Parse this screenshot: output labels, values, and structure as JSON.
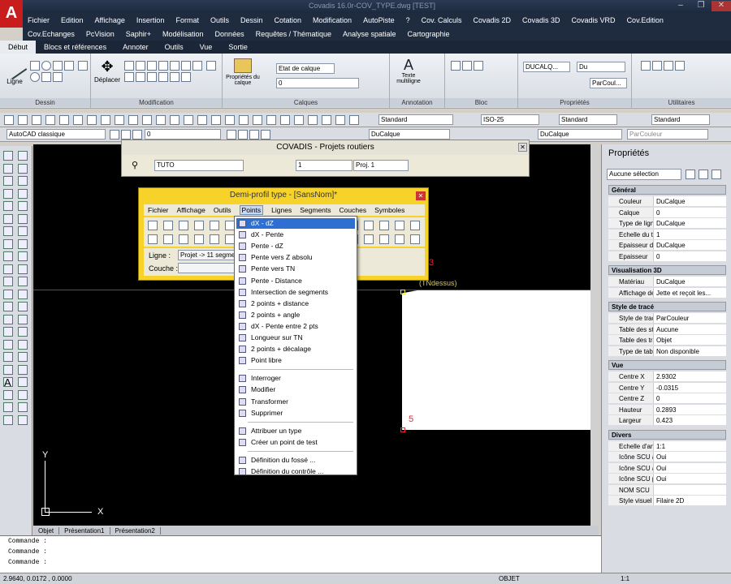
{
  "window": {
    "title": "Covadis 16.0r-COV_TYPE.dwg [TEST]"
  },
  "menubar1": [
    "Fichier",
    "Edition",
    "Affichage",
    "Insertion",
    "Format",
    "Outils",
    "Dessin",
    "Cotation",
    "Modification",
    "AutoPiste",
    "?",
    "Cov. Calculs",
    "Covadis 2D",
    "Covadis 3D",
    "Covadis VRD",
    "Cov.Edition"
  ],
  "menubar2": [
    "Cov.Echanges",
    "PcVision",
    "Saphir+",
    "Modélisation",
    "Données",
    "Requêtes / Thématique",
    "Analyse spatiale",
    "Cartographie"
  ],
  "ribbon_tabs": [
    "Début",
    "Blocs et références",
    "Annoter",
    "Outils",
    "Vue",
    "Sortie"
  ],
  "ribbon_groups": {
    "dessin": "Dessin",
    "modification": "Modification",
    "calques": "Calques",
    "annotation": "Annotation",
    "bloc": "Bloc",
    "proprietes": "Propriétés",
    "utilitaires": "Utilitaires"
  },
  "ribbon_buttons": {
    "ligne": "Ligne",
    "deplacer": "Déplacer",
    "proprietes_calque": "Propriétés du calque",
    "texte": "Texte multiligne",
    "etat_calque": "Etat de calque",
    "ducalque": "DUCALQ...",
    "parcouleur": "ParCoul...",
    "du": "Du"
  },
  "toolbar": {
    "standard1": "Standard",
    "iso": "ISO-25",
    "standard2": "Standard",
    "standard3": "Standard",
    "workspace": "AutoCAD classique",
    "layer0": "0",
    "ducalque1": "DuCalque",
    "ducalque2": "DuCalque",
    "parcouleur": "ParCouleur"
  },
  "covadis": {
    "title": "COVADIS - Projets routiers",
    "tuto": "TUTO",
    "num": "1",
    "proj": "Proj. 1"
  },
  "demiprofil": {
    "title": "Demi-profil type - [SansNom]*",
    "menu": [
      "Fichier",
      "Affichage",
      "Outils",
      "Points",
      "Lignes",
      "Segments",
      "Couches",
      "Symboles"
    ],
    "ligne_label": "Ligne :",
    "ligne_value": "Projet -> 11 segmen",
    "couche_label": "Couche :"
  },
  "points_menu": {
    "group1": [
      "dX - dZ",
      "dX - Pente",
      "Pente - dZ",
      "Pente vers Z absolu",
      "Pente vers TN",
      "Pente - Distance",
      "Intersection de segments",
      "2 points + distance",
      "2 points + angle",
      "dX - Pente entre 2 pts",
      "Longueur sur TN",
      "2 points + décalage",
      "Point libre"
    ],
    "group2": [
      "Interroger",
      "Modifier",
      "Transformer",
      "Supprimer"
    ],
    "group3": [
      "Attribuer un type",
      "Créer un point de test"
    ],
    "group4": [
      "Définition du fossé ...",
      "Définition du contrôle ..."
    ]
  },
  "canvas": {
    "label3": "3",
    "label5": "5",
    "annot": "(TNdessus)",
    "axis_y": "Y",
    "axis_x": "X"
  },
  "layout_tabs": [
    "Objet",
    "Présentation1",
    "Présentation2"
  ],
  "command": {
    "lines": [
      "Commande :",
      "Commande :",
      "Commande :"
    ]
  },
  "status": {
    "coords": "2.9640, 0.0172 , 0.0000",
    "objet": "OBJET",
    "scale": "1:1"
  },
  "properties": {
    "title": "Propriétés",
    "selection": "Aucune sélection",
    "sections": {
      "general": {
        "title": "Général",
        "rows": [
          [
            "Couleur",
            "DuCalque"
          ],
          [
            "Calque",
            "0"
          ],
          [
            "Type de ligne",
            "DuCalque"
          ],
          [
            "Echelle du ty...",
            "1"
          ],
          [
            "Epaisseur de...",
            "DuCalque"
          ],
          [
            "Epaisseur",
            "0"
          ]
        ]
      },
      "vis3d": {
        "title": "Visualisation 3D",
        "rows": [
          [
            "Matériau",
            "DuCalque"
          ],
          [
            "Affichage de...",
            "Jette et reçoit les..."
          ]
        ]
      },
      "trace": {
        "title": "Style de tracé",
        "rows": [
          [
            "Style de tracé",
            "ParCouleur"
          ],
          [
            "Table des st...",
            "Aucune"
          ],
          [
            "Table des tra...",
            "Objet"
          ],
          [
            "Type de tabl...",
            "Non disponible"
          ]
        ]
      },
      "vue": {
        "title": "Vue",
        "rows": [
          [
            "Centre X",
            "2.9302"
          ],
          [
            "Centre Y",
            "-0.0315"
          ],
          [
            "Centre Z",
            "0"
          ],
          [
            "Hauteur",
            "0.2893"
          ],
          [
            "Largeur",
            "0.423"
          ]
        ]
      },
      "divers": {
        "title": "Divers",
        "rows": [
          [
            "Echelle d'an...",
            "1:1"
          ],
          [
            "Icône SCU a...",
            "Oui"
          ],
          [
            "Icône SCU a...",
            "Oui"
          ],
          [
            "Icône SCU p...",
            "Oui"
          ],
          [
            "NOM SCU",
            ""
          ],
          [
            "Style visuel",
            "Filaire 2D"
          ]
        ]
      }
    }
  }
}
